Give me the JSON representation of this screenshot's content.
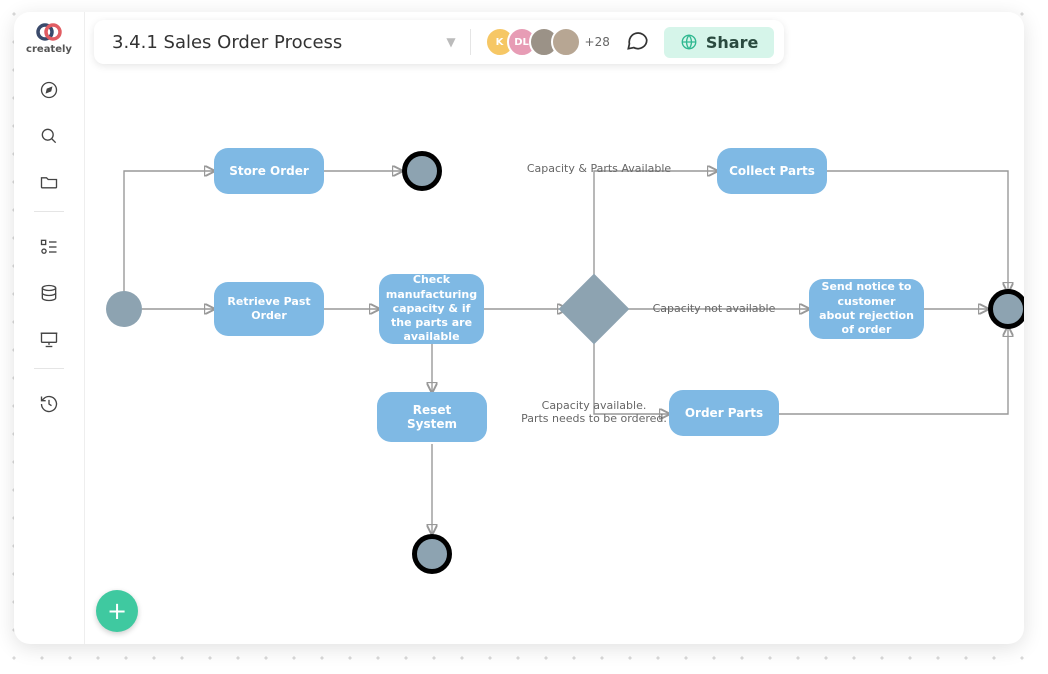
{
  "brand": "creately",
  "document": {
    "title": "3.4.1 Sales Order Process"
  },
  "collaborators": {
    "visible": [
      {
        "initials": "K",
        "bg": "#f6c765"
      },
      {
        "initials": "DL",
        "bg": "#e79cb5"
      },
      {
        "initials": "",
        "bg": "#9b9287"
      },
      {
        "initials": "",
        "bg": "#b7a693"
      }
    ],
    "overflow": "+28"
  },
  "share": {
    "label": "Share"
  },
  "rail": {
    "items": [
      "compass",
      "search",
      "folder",
      "shapes",
      "database",
      "present",
      "history"
    ]
  },
  "nodes": {
    "store_order": "Store Order",
    "retrieve": "Retrieve Past Order",
    "check": "Check manufacturing capacity & if the parts are available",
    "reset": "Reset System",
    "collect": "Collect Parts",
    "send_notice": "Send notice to customer about rejection of order",
    "order_parts": "Order Parts"
  },
  "labels": {
    "cap_parts": "Capacity & Parts Available",
    "cap_not": "Capacity not available",
    "cap_avail": "Capacity available.\nParts needs to be ordered."
  },
  "fab": "+"
}
